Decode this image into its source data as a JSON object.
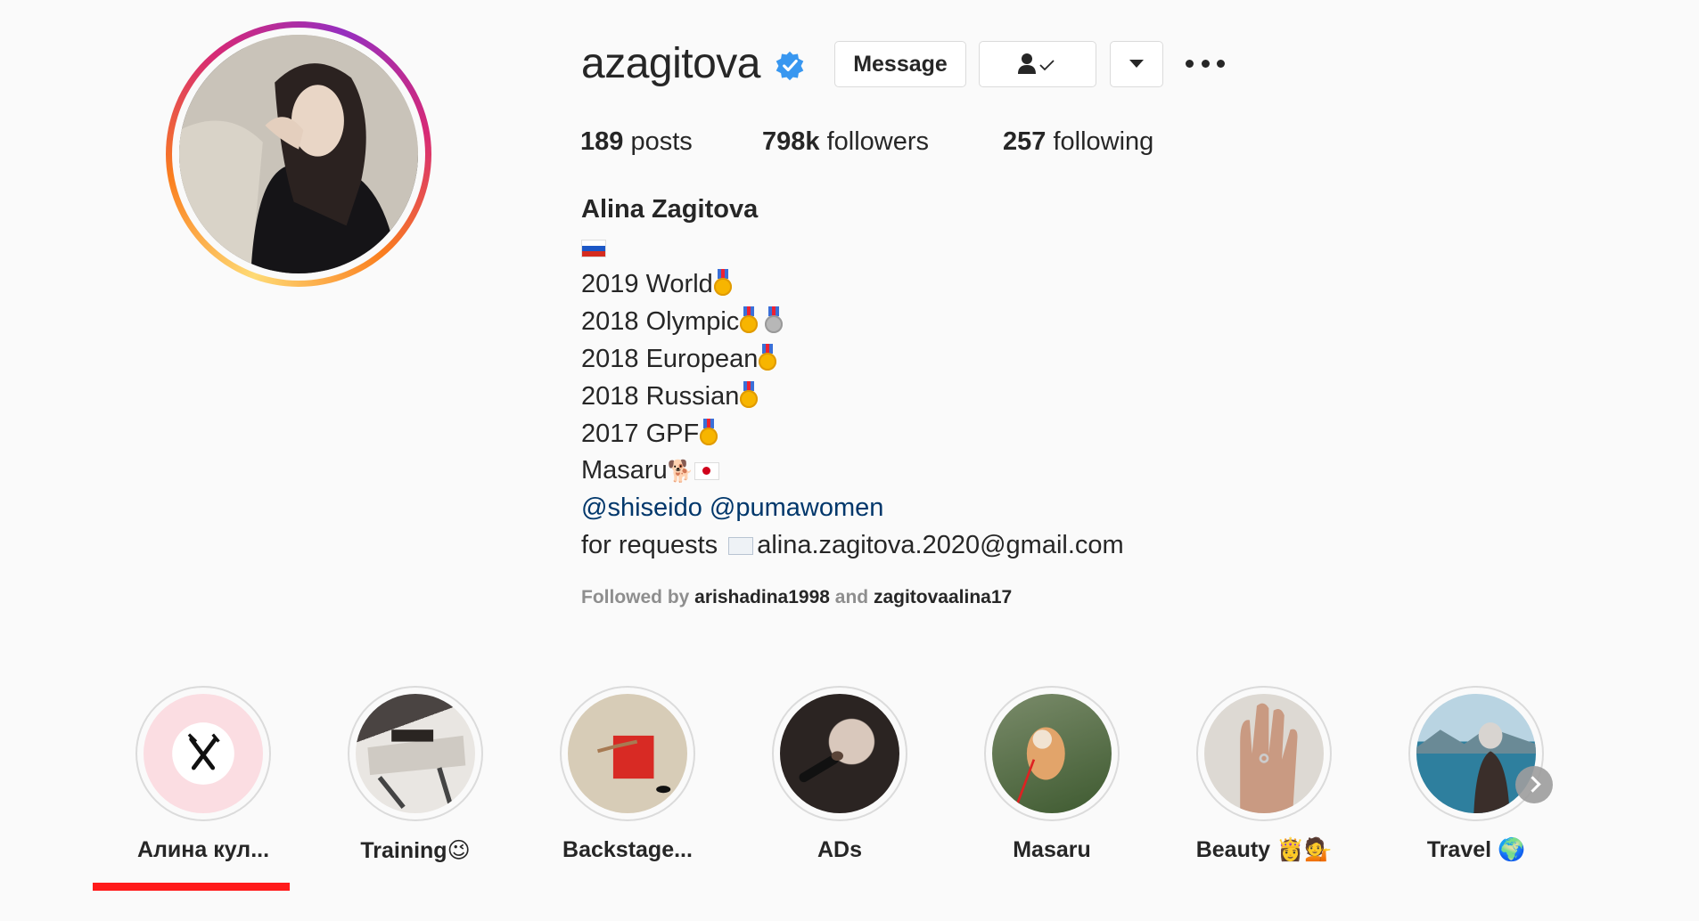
{
  "profile": {
    "username": "azagitova",
    "verified": true,
    "buttons": {
      "message": "Message",
      "following_icon": "user-check-icon",
      "dropdown_icon": "caret-down-icon",
      "more_icon": "more-options-icon"
    },
    "stats": {
      "posts_count": "189",
      "posts_label": " posts",
      "followers_count": "798k",
      "followers_label": " followers",
      "following_count": "257",
      "following_label": " following"
    },
    "full_name": "Alina Zagitova",
    "bio": {
      "line_2019": "2019 World",
      "line_2018_olympic": "2018 Olympic",
      "line_2018_european": "2018 European",
      "line_2018_russian": "2018 Russian",
      "line_2017": "2017 GPF",
      "line_masaru": "Masaru",
      "mention_1": "@shiseido",
      "mention_2": "@pumawomen",
      "requests_prefix": "for requests",
      "email": "alina.zagitova.2020@gmail.com"
    },
    "followed_by": {
      "prefix": "Followed by ",
      "user_1": "arishadina1998",
      "conjunction": " and ",
      "user_2": "zagitovaalina17"
    }
  },
  "highlights": [
    {
      "label": "Алина кул...",
      "icon": "fork-knife-icon"
    },
    {
      "label": "Training",
      "emoji": "😉"
    },
    {
      "label": "Backstage..."
    },
    {
      "label": "ADs"
    },
    {
      "label": "Masaru"
    },
    {
      "label": "Beauty ",
      "emoji": "👸💁"
    },
    {
      "label": "Travel ",
      "emoji": "🌍"
    }
  ],
  "colors": {
    "link": "#00376b",
    "verified": "#3897f0",
    "underline": "#ff1a1a",
    "text": "#262626",
    "muted": "#8e8e8e"
  }
}
